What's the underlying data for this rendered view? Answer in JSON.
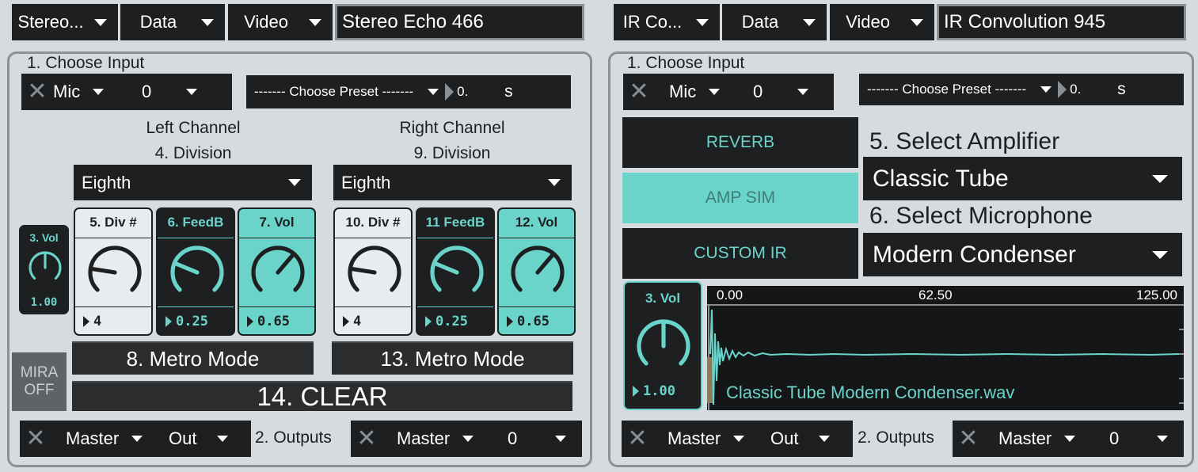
{
  "left_device": {
    "header": {
      "device_menu": "Stereo...",
      "data_menu": "Data",
      "video_menu": "Video",
      "name_field": "Stereo Echo 466"
    },
    "input_label": "1. Choose Input",
    "input": {
      "source": "Mic",
      "channel": "0"
    },
    "preset": {
      "label": "------- Choose Preset -------",
      "value": "0.",
      "unit": "s"
    },
    "left_channel": {
      "heading": "Left Channel",
      "division_label": "4. Division",
      "division_value": "Eighth",
      "dials": [
        {
          "title": "5. Div #",
          "value": "4",
          "level": 0.2
        },
        {
          "title": "6. FeedB",
          "value": "0.25",
          "level": 0.25
        },
        {
          "title": "7. Vol",
          "value": "0.65",
          "level": 0.65
        }
      ],
      "metro_label": "8. Metro Mode"
    },
    "right_channel": {
      "heading": "Right Channel",
      "division_label": "9. Division",
      "division_value": "Eighth",
      "dials": [
        {
          "title": "10. Div #",
          "value": "4",
          "level": 0.2
        },
        {
          "title": "11 FeedB",
          "value": "0.25",
          "level": 0.25
        },
        {
          "title": "12. Vol",
          "value": "0.65",
          "level": 0.65
        }
      ],
      "metro_label": "13. Metro Mode"
    },
    "master_vol": {
      "title": "3. Vol",
      "value": "1.00",
      "level": 0.5
    },
    "mira": {
      "line1": "MIRA",
      "line2": "OFF"
    },
    "clear_label": "14. CLEAR",
    "outputs": {
      "label": "2.  Outputs",
      "out1": {
        "bus": "Master",
        "channel": "Out"
      },
      "out2": {
        "bus": "Master",
        "channel": "0"
      }
    }
  },
  "right_device": {
    "header": {
      "device_menu": "IR Co...",
      "data_menu": "Data",
      "video_menu": "Video",
      "name_field": "IR Convolution 945"
    },
    "input_label": "1. Choose Input",
    "input": {
      "source": "Mic",
      "channel": "0"
    },
    "preset": {
      "label": "------- Choose Preset -------",
      "value": "0.",
      "unit": "s"
    },
    "modes": [
      {
        "label": "REVERB",
        "active": false
      },
      {
        "label": "AMP SIM",
        "active": true
      },
      {
        "label": "CUSTOM IR",
        "active": false
      }
    ],
    "amp_label": "5. Select Amplifier",
    "amp_value": "Classic Tube",
    "mic_label": "6. Select Microphone",
    "mic_value": "Modern Condenser",
    "vol": {
      "title": "3. Vol",
      "value": "1.00",
      "level": 0.5
    },
    "ir_display": {
      "ruler": [
        "0.00",
        "62.50",
        "125.00"
      ],
      "filename": "Classic Tube Modern Condenser.wav"
    },
    "outputs": {
      "label": "2.  Outputs",
      "out1": {
        "bus": "Master",
        "channel": "Out"
      },
      "out2": {
        "bus": "Master",
        "channel": "0"
      }
    }
  },
  "colors": {
    "accent": "#6ad4cb",
    "panel_bg": "#d6dbe0",
    "control_bg": "#1d1f20"
  }
}
